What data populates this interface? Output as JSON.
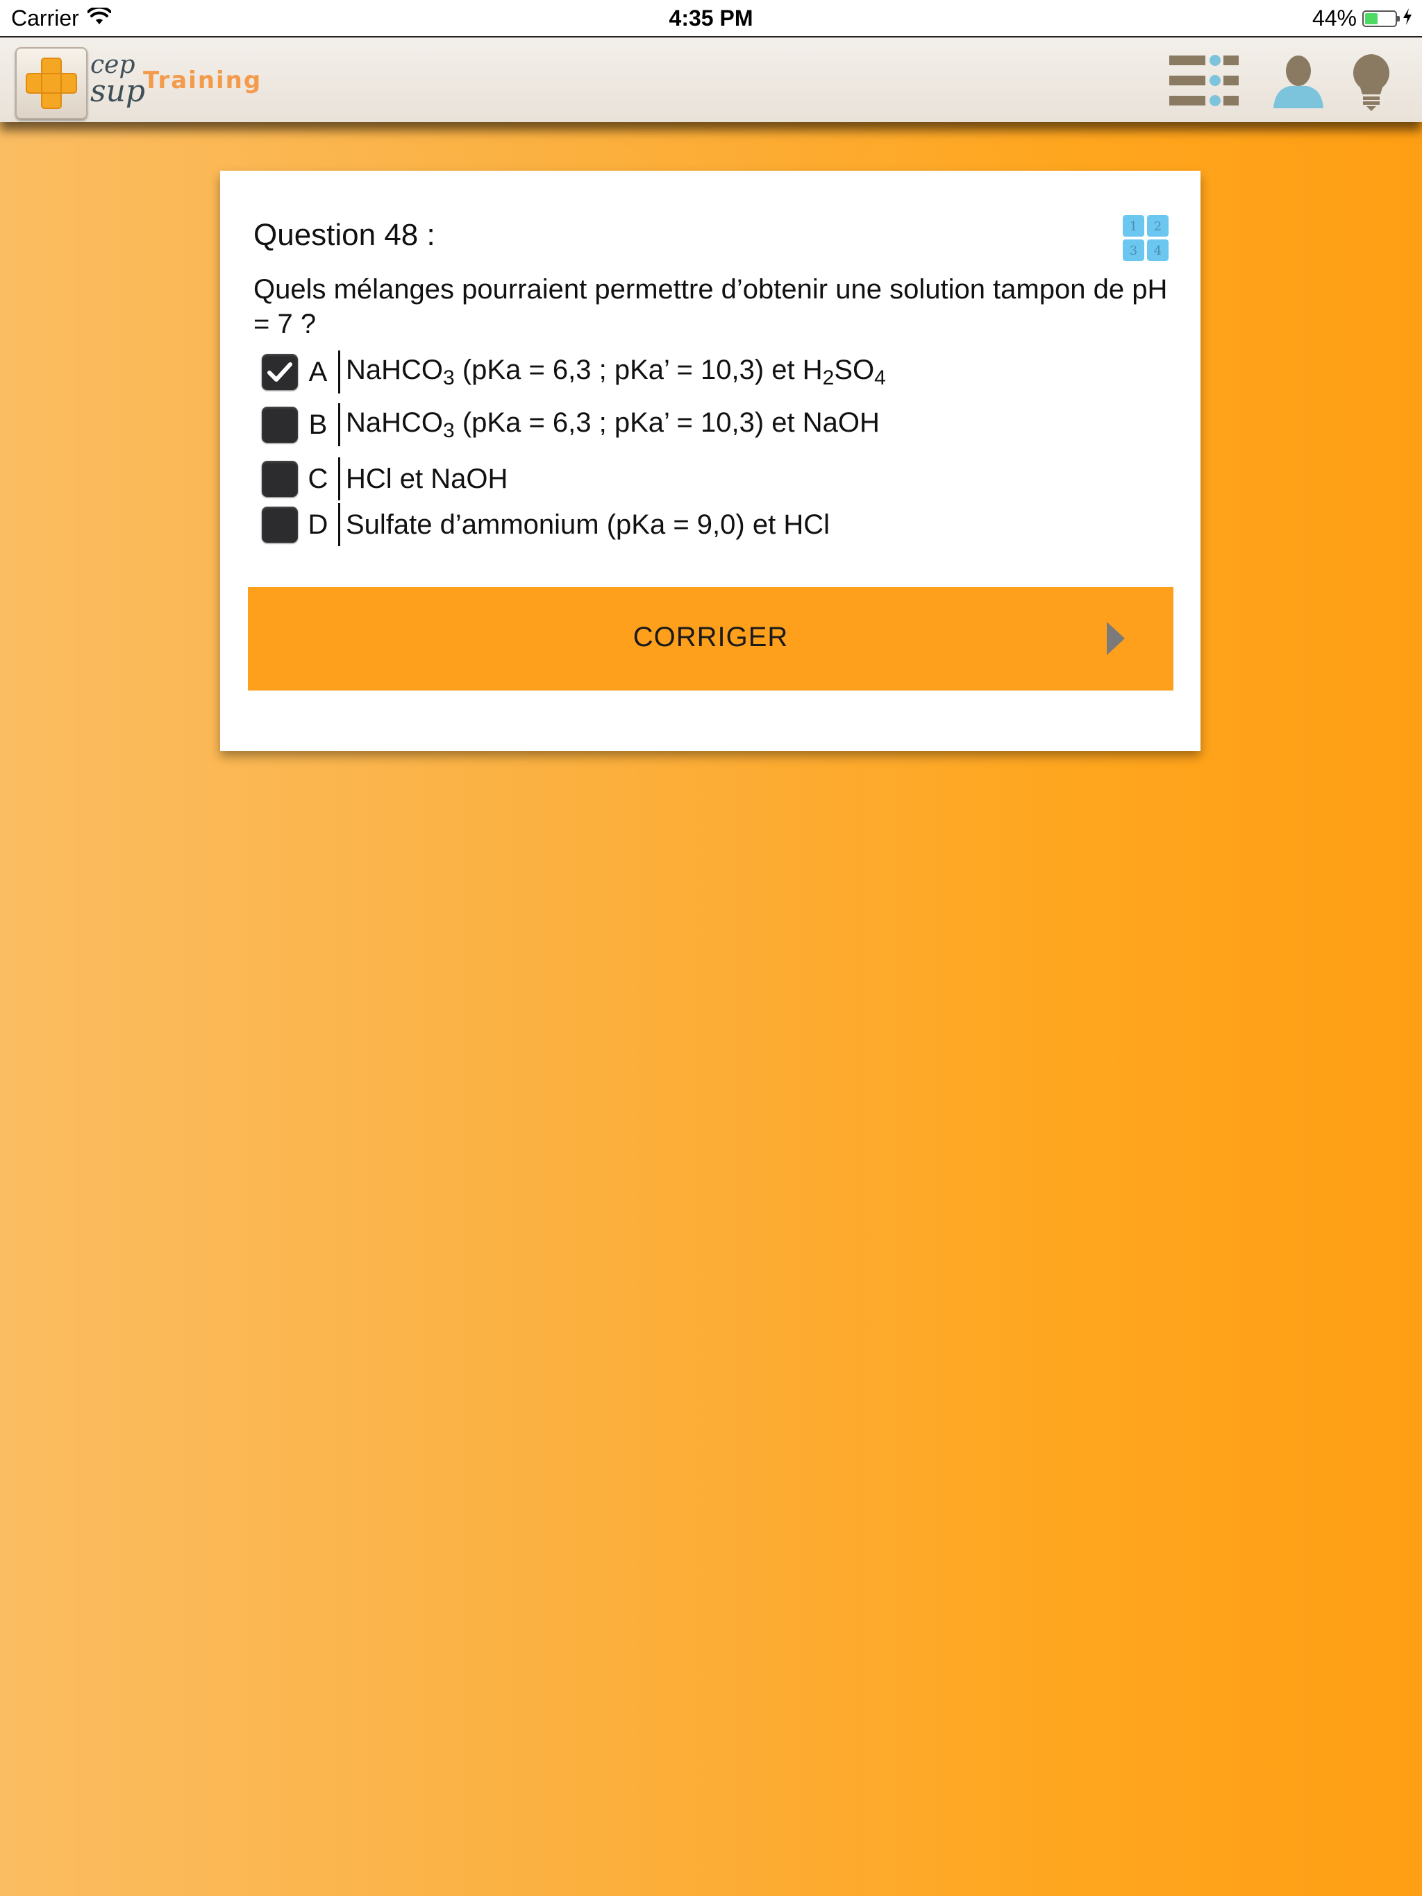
{
  "status_bar": {
    "carrier": "Carrier",
    "time": "4:35 PM",
    "battery_percent": "44%",
    "battery_level": 0.44
  },
  "header": {
    "logo_line1": "cep",
    "logo_line2": "sup",
    "logo_tagline": "Training",
    "icons": [
      "list-menu-icon",
      "user-icon",
      "lightbulb-icon"
    ]
  },
  "question": {
    "title": "Question 48 :",
    "text": "Quels mélanges pourraient permettre d’obtenir une solution tampon de pH = 7 ?",
    "grid_icon_digits": [
      "1",
      "2",
      "3",
      "4"
    ],
    "options": [
      {
        "letter": "A",
        "checked": true,
        "text_parts": [
          "NaHCO",
          "3",
          " (pKa = 6,3 ; pKa’ = 10,3) et H",
          "2",
          "SO",
          "4"
        ]
      },
      {
        "letter": "B",
        "checked": false,
        "text_parts": [
          "NaHCO",
          "3",
          " (pKa = 6,3 ; pKa’ = 10,3) et NaOH"
        ]
      },
      {
        "letter": "C",
        "checked": false,
        "text_parts": [
          "HCl et NaOH"
        ]
      },
      {
        "letter": "D",
        "checked": false,
        "text_parts": [
          "Sulfate d’ammonium (pKa = 9,0) et HCl"
        ]
      }
    ]
  },
  "actions": {
    "correct_label": "CORRIGER"
  },
  "colors": {
    "accent": "#ffa01d",
    "grid_icon": "#6cc7f0",
    "header_icon": "#8a7a62",
    "user_icon": "#7cc4dc"
  }
}
